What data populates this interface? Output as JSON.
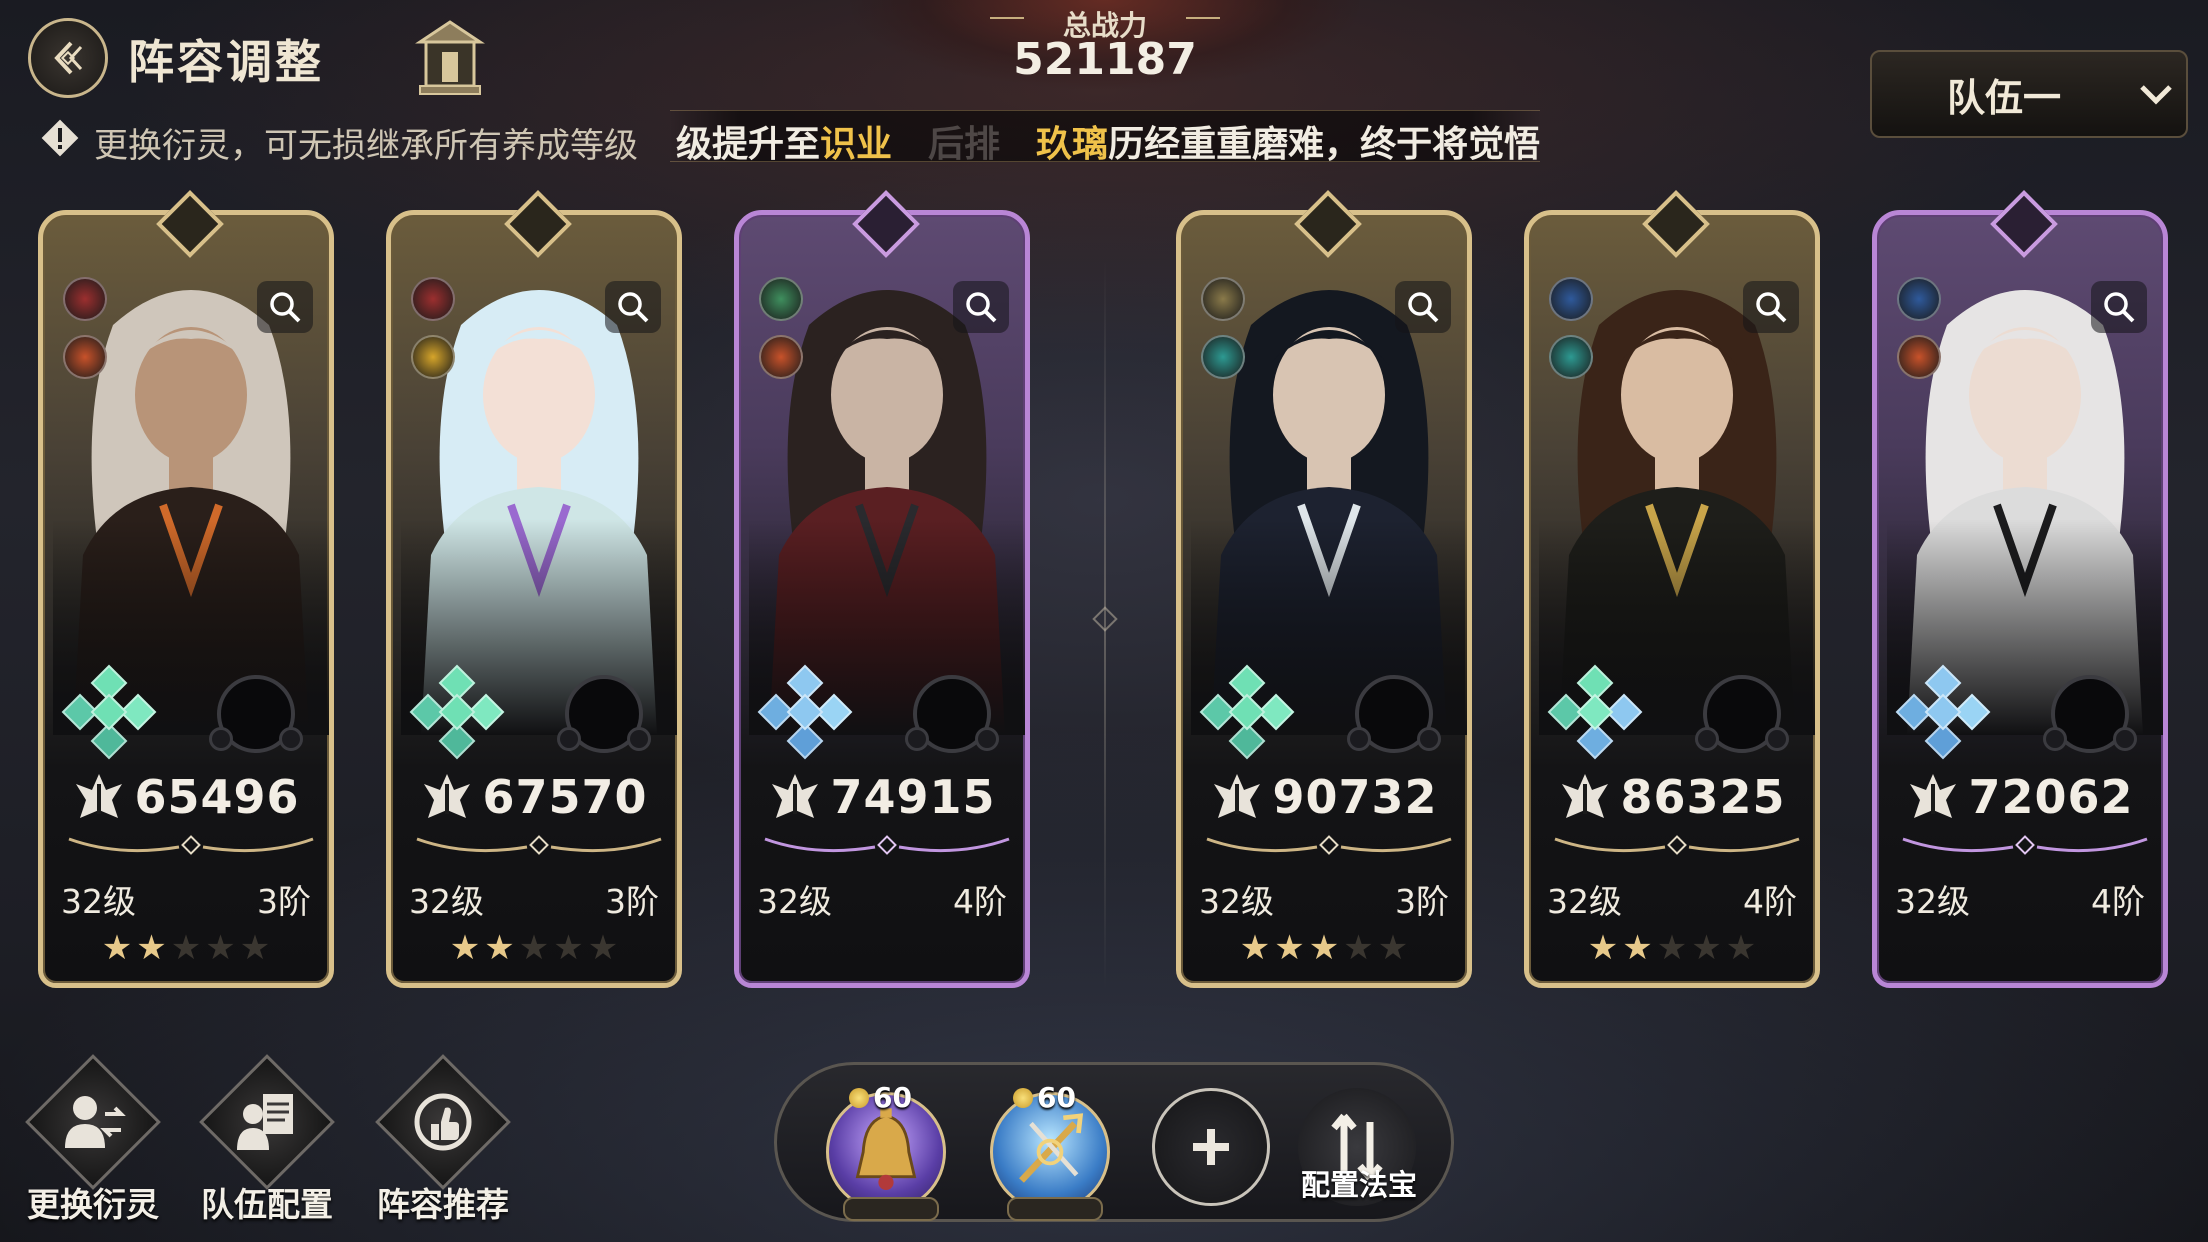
{
  "header": {
    "title": "阵容调整",
    "tip": "更换衍灵，可无损继承所有养成等级",
    "marquee": {
      "part1": "级提升至",
      "part1_hl": "识业",
      "part2_faded": "后排",
      "part3_hl": "玖璃",
      "part3": "历经重重磨难，终于将觉悟"
    },
    "total_power_label": "总战力",
    "total_power": "521187",
    "team_select": "队伍一"
  },
  "cards": [
    {
      "frame": "gold",
      "power": "65496",
      "level": "32级",
      "stage": "3阶",
      "stars_on": 2,
      "stars_total": 5,
      "icons": [
        "weapon-icon",
        "fire-element-icon"
      ],
      "gems": "green"
    },
    {
      "frame": "gold",
      "power": "67570",
      "level": "32级",
      "stage": "3阶",
      "stars_on": 2,
      "stars_total": 5,
      "icons": [
        "weapon-icon",
        "sun-element-icon"
      ],
      "gems": "green"
    },
    {
      "frame": "purple",
      "power": "74915",
      "level": "32级",
      "stage": "4阶",
      "stars_on": 0,
      "stars_total": 0,
      "icons": [
        "wind-element-icon",
        "fire-element-icon"
      ],
      "gems": "blue"
    },
    {
      "frame": "gold",
      "power": "90732",
      "level": "32级",
      "stage": "3阶",
      "stars_on": 3,
      "stars_total": 5,
      "icons": [
        "shield-icon",
        "water-element-icon"
      ],
      "gems": "green"
    },
    {
      "frame": "gold",
      "power": "86325",
      "level": "32级",
      "stage": "4阶",
      "stars_on": 2,
      "stars_total": 5,
      "icons": [
        "sword-icon",
        "water-element-icon"
      ],
      "gems": "mixed"
    },
    {
      "frame": "purple",
      "power": "72062",
      "level": "32级",
      "stage": "4阶",
      "stars_on": 0,
      "stars_total": 0,
      "icons": [
        "sword-icon",
        "fire-element-icon"
      ],
      "gems": "blue"
    }
  ],
  "actions": [
    {
      "label": "更换衍灵",
      "icon": "swap-spirit-icon"
    },
    {
      "label": "队伍配置",
      "icon": "team-config-icon"
    },
    {
      "label": "阵容推荐",
      "icon": "recommend-icon"
    }
  ],
  "treasures": [
    {
      "cost": "60",
      "icon": "bell-treasure-icon"
    },
    {
      "cost": "60",
      "icon": "trident-treasure-icon"
    }
  ],
  "configure_treasure_label": "配置法宝",
  "colors": {
    "gold_frame": "#d8c08a",
    "purple_frame": "#b986d6",
    "highlight": "#f0c24a"
  }
}
